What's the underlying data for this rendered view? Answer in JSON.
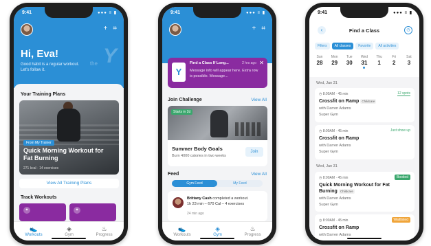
{
  "status_time": "9:41",
  "status_icons": "●●● ≡ ▮",
  "phone1": {
    "greeting": "Hi, Eva!",
    "subtitle": "Good habit is a regular workout. Let's follow it.",
    "brand_word": "the",
    "brand_mark": "Y",
    "training_plans_title": "Your Training Plans",
    "plan": {
      "tag": "From My Trainer",
      "title": "Quick Morning Workout for Fat Burning",
      "meta": "271 kcal · 14 exercises"
    },
    "view_all_plans": "View All Training Plans",
    "track_workouts_title": "Track Workouts"
  },
  "phone2": {
    "message": {
      "title": "Find a Class If Long...",
      "time": "2 hrs ago",
      "body": "Message info will appear here. Extra row is possible. Message..."
    },
    "join_challenge_title": "Join Challenge",
    "view_all": "View All",
    "challenge": {
      "badge": "Starts in 2d",
      "title": "Summer Body Goals",
      "subtitle": "Burn 4000 calories in two weeks",
      "join": "Join"
    },
    "feed_title": "Feed",
    "feed_view_all": "View All",
    "feed_tabs": [
      "Gym Feed",
      "My Feed"
    ],
    "feed_item": {
      "name": "Brittany Cash",
      "action": "completed a workout.",
      "detail": "1h 23 min – 670 Cal – 4 exercises",
      "time": "24 min ago"
    }
  },
  "phone3": {
    "title": "Find a Class",
    "chips": [
      "Filters",
      "All classes",
      "Favorite",
      "All activities"
    ],
    "days": [
      {
        "name": "Sun",
        "num": "28"
      },
      {
        "name": "Mon",
        "num": "29"
      },
      {
        "name": "Tue",
        "num": "30"
      },
      {
        "name": "Wed",
        "num": "31"
      },
      {
        "name": "Thu",
        "num": "1"
      },
      {
        "name": "Fri",
        "num": "2"
      },
      {
        "name": "Sat",
        "num": "3"
      }
    ],
    "date_header_1": "Wed, Jan 31",
    "date_header_2": "Wed, Jan 31",
    "classes": [
      {
        "time": "8:00AM · 45 min",
        "badge": "12 spots",
        "name": "Crossfit on Ramp",
        "tag": "Childcare",
        "instructor": "with Darren Adams",
        "gym": "Super Gym"
      },
      {
        "time": "8:00AM · 45 min",
        "badge": "Just show up",
        "name": "Crossfit on Ramp",
        "instructor": "with Darren Adams",
        "gym": "Super Gym"
      },
      {
        "time": "8:00AM · 45 min",
        "badge": "Booked",
        "name": "Quick Morning Workout for Fat Burning",
        "tag": "Childcare",
        "instructor": "with Darren Adams",
        "gym": "Super Gym"
      },
      {
        "time": "8:00AM · 45 min",
        "badge": "Waitlisted",
        "name": "Crossfit on Ramp",
        "instructor": "with Darren Adams"
      }
    ]
  },
  "tabs": [
    "Workouts",
    "Gym",
    "Progress"
  ],
  "colors": {
    "primary": "#2b8fd6",
    "purple": "#8a2ba0",
    "green": "#3aa76d",
    "orange": "#f0a53a"
  },
  "icons": {
    "add": "plus-icon",
    "scan": "scan-icon",
    "close": "close-icon",
    "clock": "clock-icon",
    "back": "chevron-left-icon",
    "workouts": "sneaker-icon",
    "gym": "gym-icon",
    "progress": "flame-icon"
  }
}
